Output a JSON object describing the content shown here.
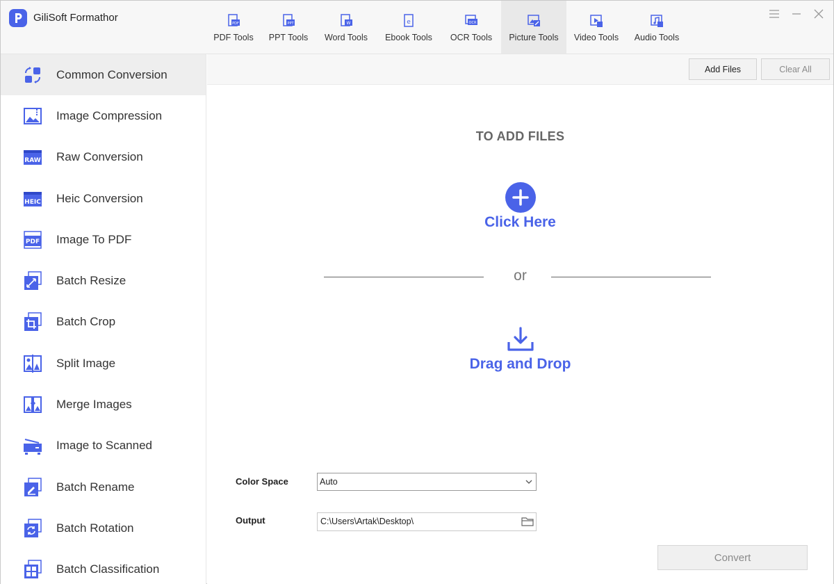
{
  "app": {
    "title": "GiliSoft Formathor"
  },
  "tabs": [
    {
      "label": "PDF Tools",
      "icon": "pdf-tools-icon",
      "active": false
    },
    {
      "label": "PPT Tools",
      "icon": "ppt-tools-icon",
      "active": false
    },
    {
      "label": "Word Tools",
      "icon": "word-tools-icon",
      "active": false
    },
    {
      "label": "Ebook Tools",
      "icon": "ebook-tools-icon",
      "active": false
    },
    {
      "label": "OCR Tools",
      "icon": "ocr-tools-icon",
      "active": false
    },
    {
      "label": "Picture Tools",
      "icon": "picture-tools-icon",
      "active": true
    },
    {
      "label": "Video Tools",
      "icon": "video-tools-icon",
      "active": false
    },
    {
      "label": "Audio Tools",
      "icon": "audio-tools-icon",
      "active": false
    }
  ],
  "sidebar": {
    "items": [
      {
        "label": "Common Conversion",
        "icon": "common-conversion-icon",
        "active": true
      },
      {
        "label": "Image Compression",
        "icon": "image-compression-icon"
      },
      {
        "label": "Raw Conversion",
        "icon": "raw-icon"
      },
      {
        "label": "Heic Conversion",
        "icon": "heic-icon"
      },
      {
        "label": "Image To PDF",
        "icon": "pdf-icon"
      },
      {
        "label": "Batch Resize",
        "icon": "resize-icon"
      },
      {
        "label": "Batch Crop",
        "icon": "crop-icon"
      },
      {
        "label": "Split Image",
        "icon": "split-image-icon"
      },
      {
        "label": "Merge Images",
        "icon": "merge-images-icon"
      },
      {
        "label": "Image to Scanned",
        "icon": "scanner-icon"
      },
      {
        "label": "Batch Rename",
        "icon": "rename-icon"
      },
      {
        "label": "Batch Rotation",
        "icon": "rotation-icon"
      },
      {
        "label": "Batch Classification",
        "icon": "classification-icon"
      }
    ]
  },
  "toolbar": {
    "add_files": "Add Files",
    "clear_all": "Clear All"
  },
  "dropzone": {
    "title": "TO ADD FILES",
    "click_here": "Click Here",
    "or": "or",
    "drag_drop": "Drag and Drop"
  },
  "settings": {
    "color_space_label": "Color Space",
    "color_space_value": "Auto",
    "output_label": "Output",
    "output_value": "C:\\Users\\Artak\\Desktop\\"
  },
  "convert_label": "Convert",
  "colors": {
    "accent": "#4a63e8",
    "sidebar_active": "#eeeeee",
    "tab_active": "#e9e9e9"
  }
}
